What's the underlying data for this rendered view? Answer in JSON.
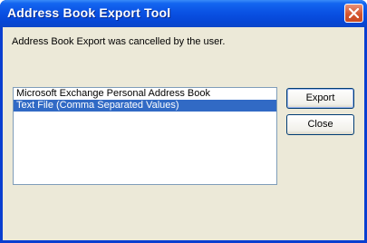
{
  "window": {
    "title": "Address Book Export Tool"
  },
  "message": "Address Book Export was cancelled by the user.",
  "list": {
    "items": [
      "Microsoft Exchange Personal Address Book",
      "Text File (Comma Separated Values)"
    ],
    "selected_index": 1
  },
  "buttons": {
    "export_label": "Export",
    "close_label": "Close"
  },
  "colors": {
    "titlebar": "#0a52e4",
    "dialog_background": "#ece9d8",
    "selection": "#316ac5",
    "close_button": "#d4562f"
  }
}
